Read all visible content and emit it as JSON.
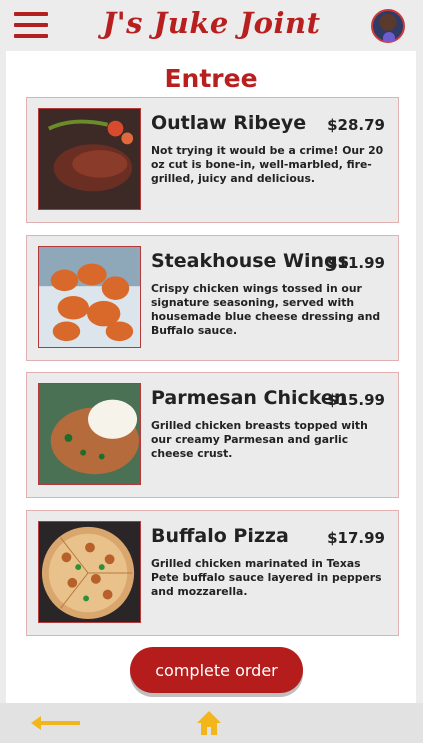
{
  "header": {
    "brand": "J's Juke Joint",
    "menu_icon": "menu-icon",
    "avatar_icon": "avatar"
  },
  "page": {
    "title": "Entree"
  },
  "items": [
    {
      "name": "Outlaw Ribeye",
      "price": "$28.79",
      "description": "Not trying it would be a crime! Our 20 oz cut is bone-in, well-marbled, fire-grilled, juicy and delicious."
    },
    {
      "name": "Steakhouse Wings",
      "price": "$11.99",
      "description": "Crispy chicken wings tossed in our signature seasoning, served with housemade blue cheese dressing and Buffalo sauce."
    },
    {
      "name": "Parmesan Chicken",
      "price": "$15.99",
      "description": "Grilled chicken breasts topped with our creamy Parmesan and garlic cheese crust."
    },
    {
      "name": "Buffalo Pizza",
      "price": "$17.99",
      "description": "Grilled chicken marinated in Texas Pete buffalo sauce layered in peppers and mozzarella."
    }
  ],
  "actions": {
    "complete_label": "complete order"
  },
  "footer": {
    "back_icon": "back-arrow-icon",
    "home_icon": "home-icon"
  },
  "colors": {
    "brand": "#b82020",
    "button": "#b51d1d",
    "footer_icon": "#f2b51b"
  }
}
